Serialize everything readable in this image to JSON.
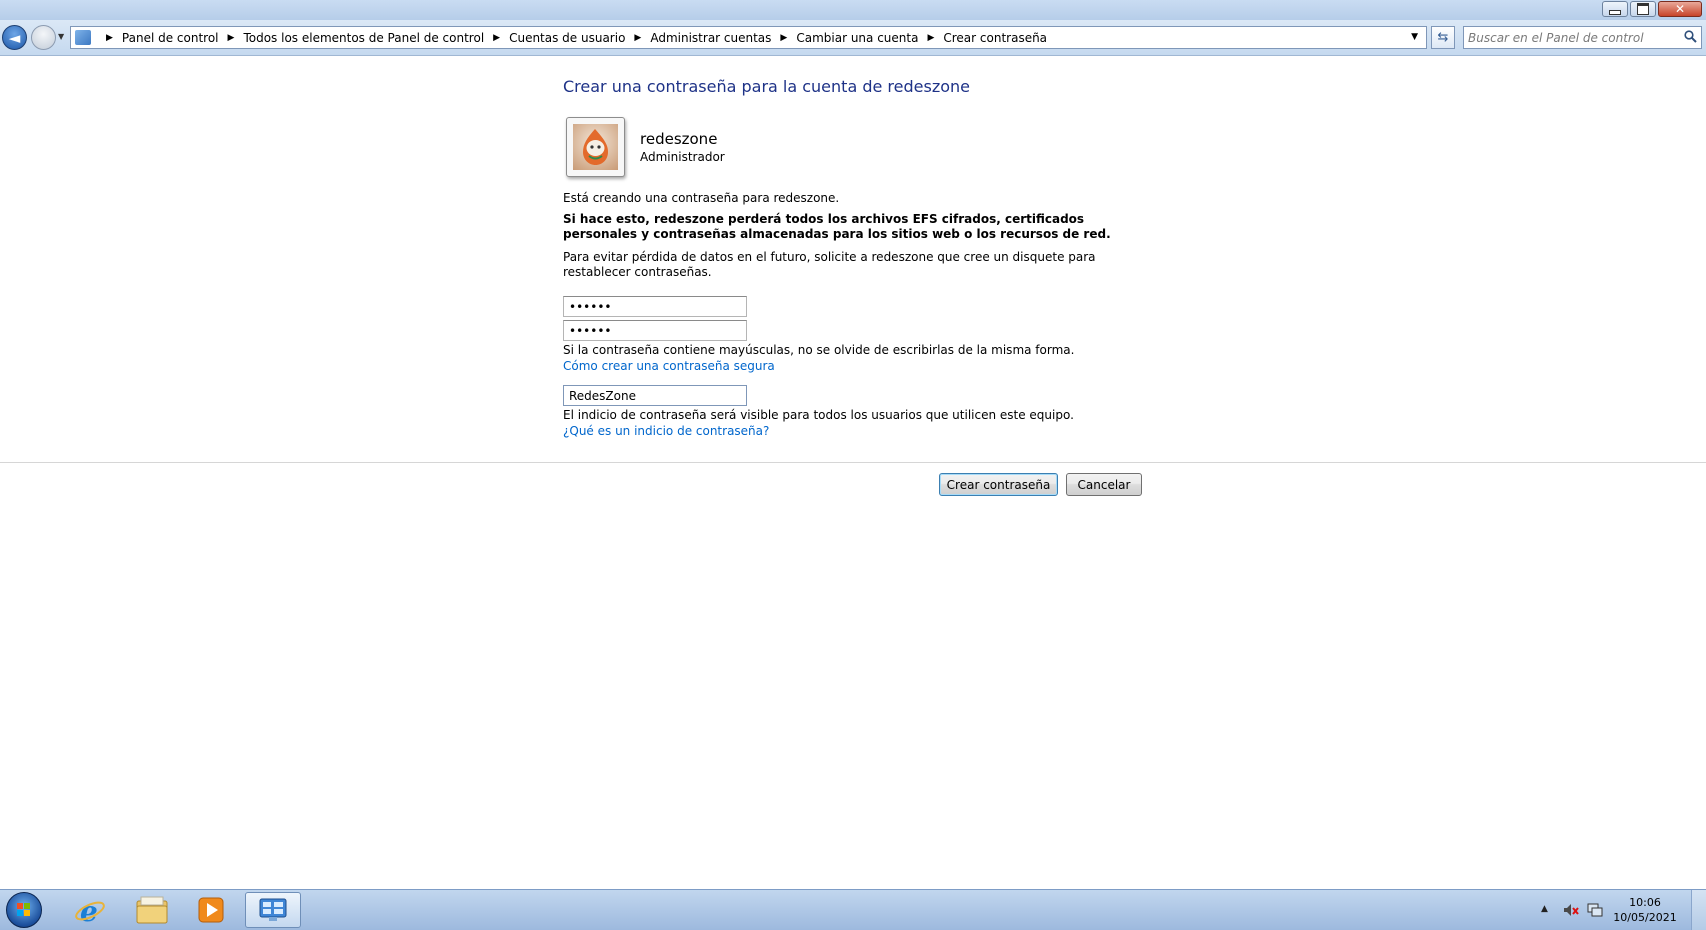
{
  "window": {
    "controls": {
      "minimize": "minimize-icon",
      "restore": "restore-icon",
      "close": "close-icon"
    }
  },
  "navigation": {
    "breadcrumb": [
      "Panel de control",
      "Todos los elementos de Panel de control",
      "Cuentas de usuario",
      "Administrar cuentas",
      "Cambiar una cuenta",
      "Crear contraseña"
    ],
    "search_placeholder": "Buscar en el Panel de control"
  },
  "page": {
    "title": "Crear una contraseña para la cuenta de redeszone",
    "account": {
      "name": "redeszone",
      "type": "Administrador"
    },
    "info_text": "Está creando una contraseña para redeszone.",
    "warning_text": "Si hace esto, redeszone perderá todos los archivos EFS cifrados, certificados personales y contraseñas almacenadas para los sitios web o los recursos de red.",
    "advice_text": "Para evitar pérdida de datos en el futuro, solicite a redeszone que cree un disquete para restablecer contraseñas.",
    "password_value": "••••••",
    "confirm_value": "••••••",
    "case_note": "Si la contraseña contiene mayúsculas, no se olvide de escribirlas de la misma forma.",
    "strong_password_link": "Cómo crear una contraseña segura",
    "hint_value": "RedesZone",
    "hint_note": "El indicio de contraseña será visible para todos los usuarios que utilicen este equipo.",
    "hint_link": "¿Qué es un indicio de contraseña?",
    "create_button": "Crear contraseña",
    "cancel_button": "Cancelar"
  },
  "taskbar": {
    "pinned": [
      "internet-explorer-icon",
      "windows-explorer-icon",
      "media-player-icon",
      "control-panel-icon"
    ],
    "tray": [
      "speaker-muted-icon",
      "network-icon"
    ],
    "time": "10:06",
    "date": "10/05/2021"
  }
}
